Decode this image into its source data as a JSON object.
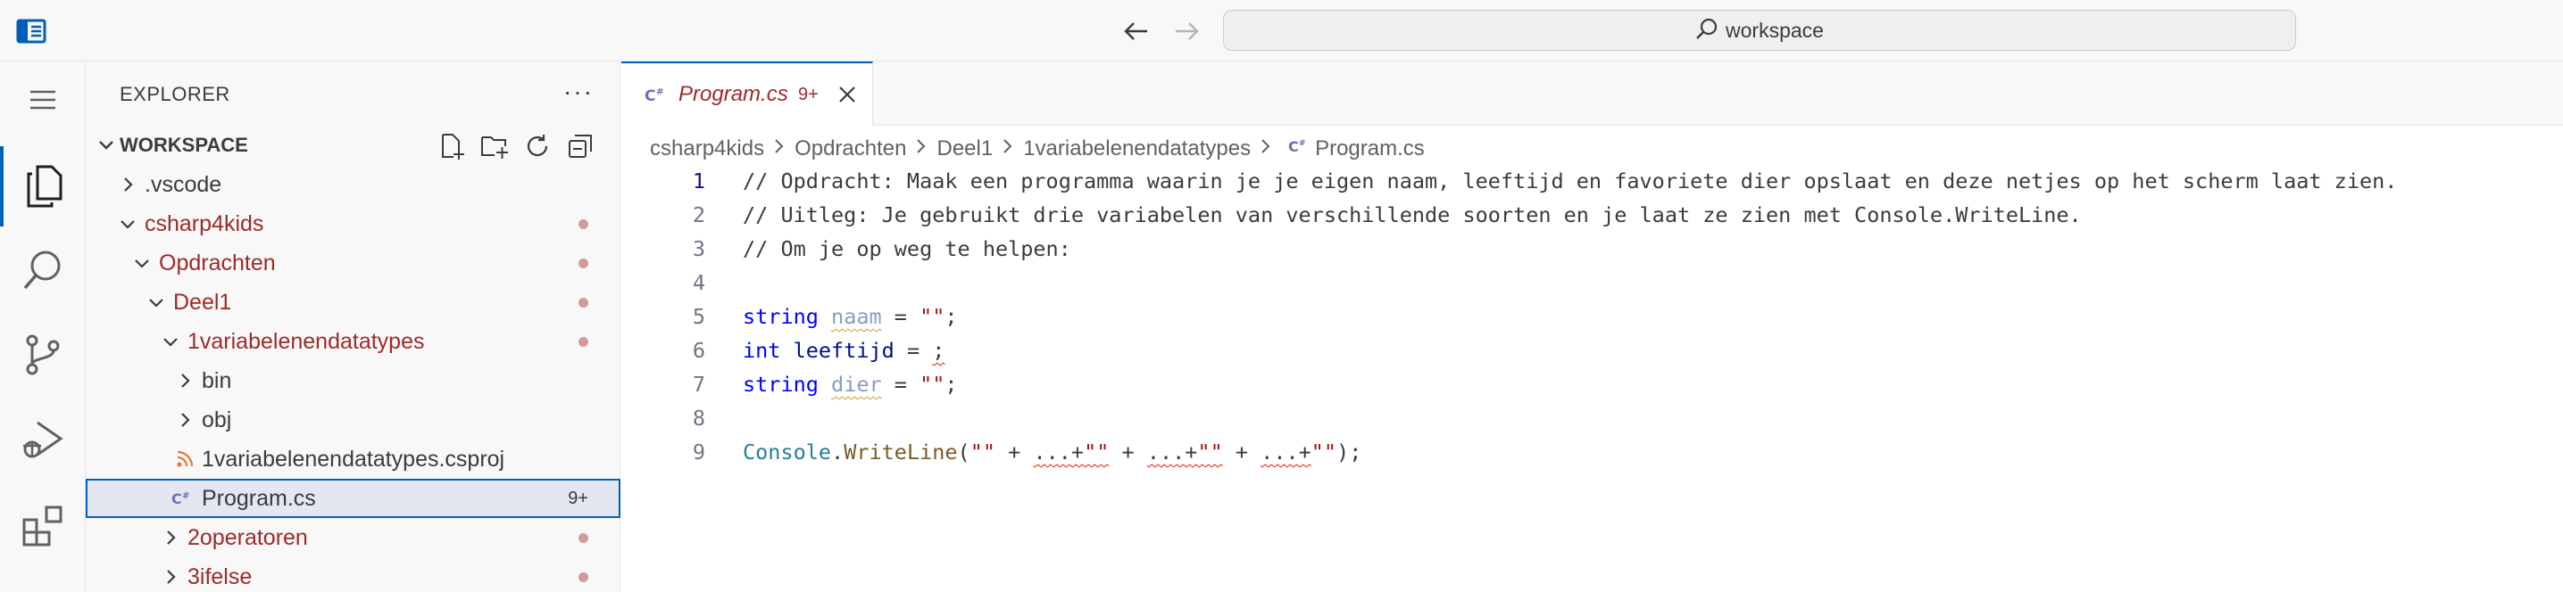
{
  "titlebar": {
    "search_text": "workspace",
    "icons": [
      "sidebar-layout-icon",
      "arrow-left-icon",
      "arrow-right-icon",
      "search-icon"
    ]
  },
  "activitybar": {
    "items": [
      "menu",
      "explorer",
      "search",
      "source-control",
      "run-debug",
      "extensions"
    ],
    "active": "explorer",
    "accent": "#005fb8"
  },
  "sidebar": {
    "title": "EXPLORER",
    "more": "···",
    "workspace_label": "WORKSPACE",
    "items": [
      {
        "label": ".vscode",
        "modified": false
      },
      {
        "label": "csharp4kids",
        "modified": true
      },
      {
        "label": "Opdrachten",
        "modified": true
      },
      {
        "label": "Deel1",
        "modified": true
      },
      {
        "label": "1variabelenendatatypes",
        "modified": true
      },
      {
        "label": "bin",
        "modified": false
      },
      {
        "label": "obj",
        "modified": false
      },
      {
        "label": "1variabelenendatatypes.csproj",
        "modified": false
      },
      {
        "label": "Program.cs",
        "problems": "9+",
        "selected": true
      },
      {
        "label": "2operatoren",
        "modified": true
      },
      {
        "label": "3ifelse",
        "modified": true
      }
    ]
  },
  "editor": {
    "tab": {
      "name": "Program.cs",
      "count": "9+"
    },
    "breadcrumb": [
      "csharp4kids",
      "Opdrachten",
      "Deel1",
      "1variabelenendatatypes",
      "Program.cs"
    ],
    "lines": [
      "1",
      "2",
      "3",
      "4",
      "5",
      "6",
      "7",
      "8",
      "9"
    ],
    "code": {
      "l1": "// Opdracht: Maak een programma waarin je je eigen naam, leeftijd en favoriete dier opslaat en deze netjes op het scherm laat zien.",
      "l2": "// Uitleg: Je gebruikt drie variabelen van verschillende soorten en je laat ze zien met Console.WriteLine.",
      "l3": "// Om je op weg te helpen:",
      "l5_kw": "string",
      "l5_var": "naam",
      "l5_rest": " = ",
      "l5_str": "\"\"",
      "l5_end": ";",
      "l6_kw": "int",
      "l6_var": "leeftijd",
      "l6_rest": " = ",
      "l6_err": ";",
      "l7_kw": "string",
      "l7_var": "dier",
      "l7_rest": " = ",
      "l7_str": "\"\"",
      "l7_end": ";",
      "l9_cls": "Console",
      "l9_dot": ".",
      "l9_fn": "WriteLine",
      "l9_open": "(",
      "l9_s1": "\"\"",
      "l9_p1": " + ",
      "l9_e1": "...",
      "l9_p2": "+",
      "l9_s2": "\"\"",
      "l9_p3": " + ",
      "l9_e2": "...",
      "l9_p4": "+",
      "l9_s3": "\"\"",
      "l9_p5": " + ",
      "l9_e3": "...",
      "l9_p6": "+",
      "l9_s4": "\"\"",
      "l9_close": ");"
    }
  }
}
